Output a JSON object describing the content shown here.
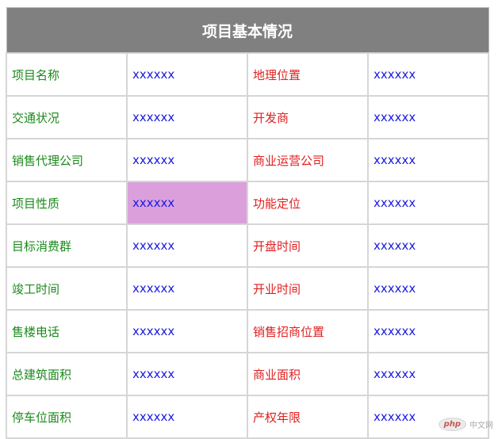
{
  "table": {
    "title": "项目基本情况",
    "rows": [
      {
        "label1": "项目名称",
        "value1": "xxxxxx",
        "label2": "地理位置",
        "value2": "xxxxxx"
      },
      {
        "label1": "交通状况",
        "value1": "xxxxxx",
        "label2": "开发商",
        "value2": "xxxxxx"
      },
      {
        "label1": "销售代理公司",
        "value1": "xxxxxx",
        "label2": "商业运营公司",
        "value2": "xxxxxx"
      },
      {
        "label1": "项目性质",
        "value1": "xxxxxx",
        "label2": "功能定位",
        "value2": "xxxxxx"
      },
      {
        "label1": "目标消费群",
        "value1": "xxxxxx",
        "label2": "开盘时间",
        "value2": "xxxxxx"
      },
      {
        "label1": "竣工时间",
        "value1": "xxxxxx",
        "label2": "开业时间",
        "value2": "xxxxxx"
      },
      {
        "label1": "售楼电话",
        "value1": "xxxxxx",
        "label2": "销售招商位置",
        "value2": "xxxxxx"
      },
      {
        "label1": "总建筑面积",
        "value1": "xxxxxx",
        "label2": "商业面积",
        "value2": "xxxxxx"
      },
      {
        "label1": "停车位面积",
        "value1": "xxxxxx",
        "label2": "产权年限",
        "value2": "xxxxxx"
      }
    ]
  },
  "colors": {
    "header_bg": "#808080",
    "label_left": "#1a8a1a",
    "label_right": "#e02020",
    "value": "#1a1ae0",
    "highlight": "#dba0dc"
  },
  "watermark": {
    "logo": "php",
    "text": "中文网"
  }
}
